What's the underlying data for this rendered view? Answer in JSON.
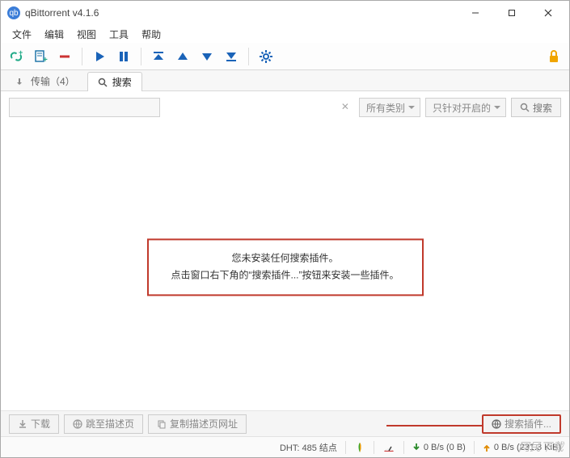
{
  "titlebar": {
    "app_icon_text": "qb",
    "title": "qBittorrent v4.1.6"
  },
  "menubar": {
    "file": "文件",
    "edit": "编辑",
    "view": "视图",
    "tools": "工具",
    "help": "帮助"
  },
  "tabs": {
    "transfers": "传输（4）",
    "search": "搜索"
  },
  "search": {
    "placeholder": "",
    "category_label": "所有类别",
    "enabled_label": "只针对开启的",
    "search_btn": "搜索"
  },
  "notice": {
    "line1": "您未安装任何搜索插件。",
    "line2": "点击窗口右下角的“搜索插件...”按钮来安装一些插件。"
  },
  "bottom": {
    "download": "下载",
    "goto_desc": "跳至描述页",
    "copy_url": "复制描述页网址",
    "plugins": "搜索插件..."
  },
  "status": {
    "dht": "DHT: 485 结点",
    "down": "0  B/s (0  B)",
    "up": "0  B/s (231.3  KiB)"
  },
  "watermark": "网民下载"
}
